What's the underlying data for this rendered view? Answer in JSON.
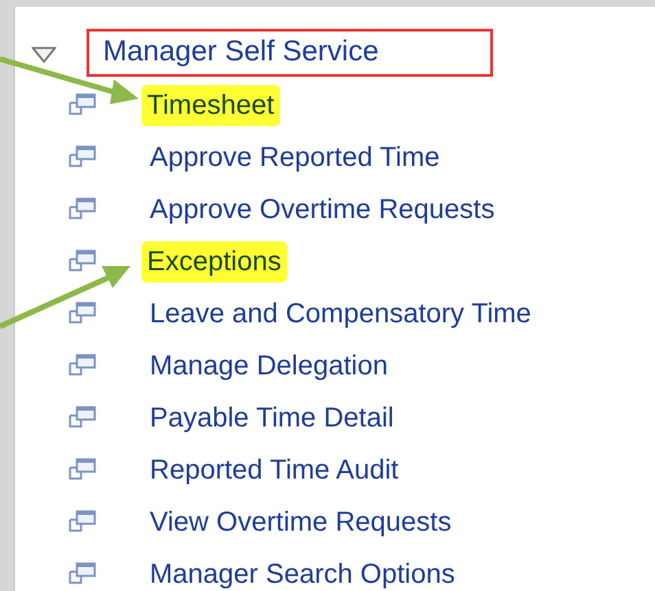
{
  "menu": {
    "title": "Manager Self Service",
    "expanded": true,
    "items": [
      {
        "label": "Timesheet",
        "highlighted": true
      },
      {
        "label": "Approve Reported Time",
        "highlighted": false
      },
      {
        "label": "Approve Overtime Requests",
        "highlighted": false
      },
      {
        "label": "Exceptions",
        "highlighted": true
      },
      {
        "label": "Leave and Compensatory Time",
        "highlighted": false
      },
      {
        "label": "Manage Delegation",
        "highlighted": false
      },
      {
        "label": "Payable Time Detail",
        "highlighted": false
      },
      {
        "label": "Reported Time Audit",
        "highlighted": false
      },
      {
        "label": "View Overtime Requests",
        "highlighted": false
      },
      {
        "label": "Manager Search Options",
        "highlighted": false
      }
    ]
  }
}
